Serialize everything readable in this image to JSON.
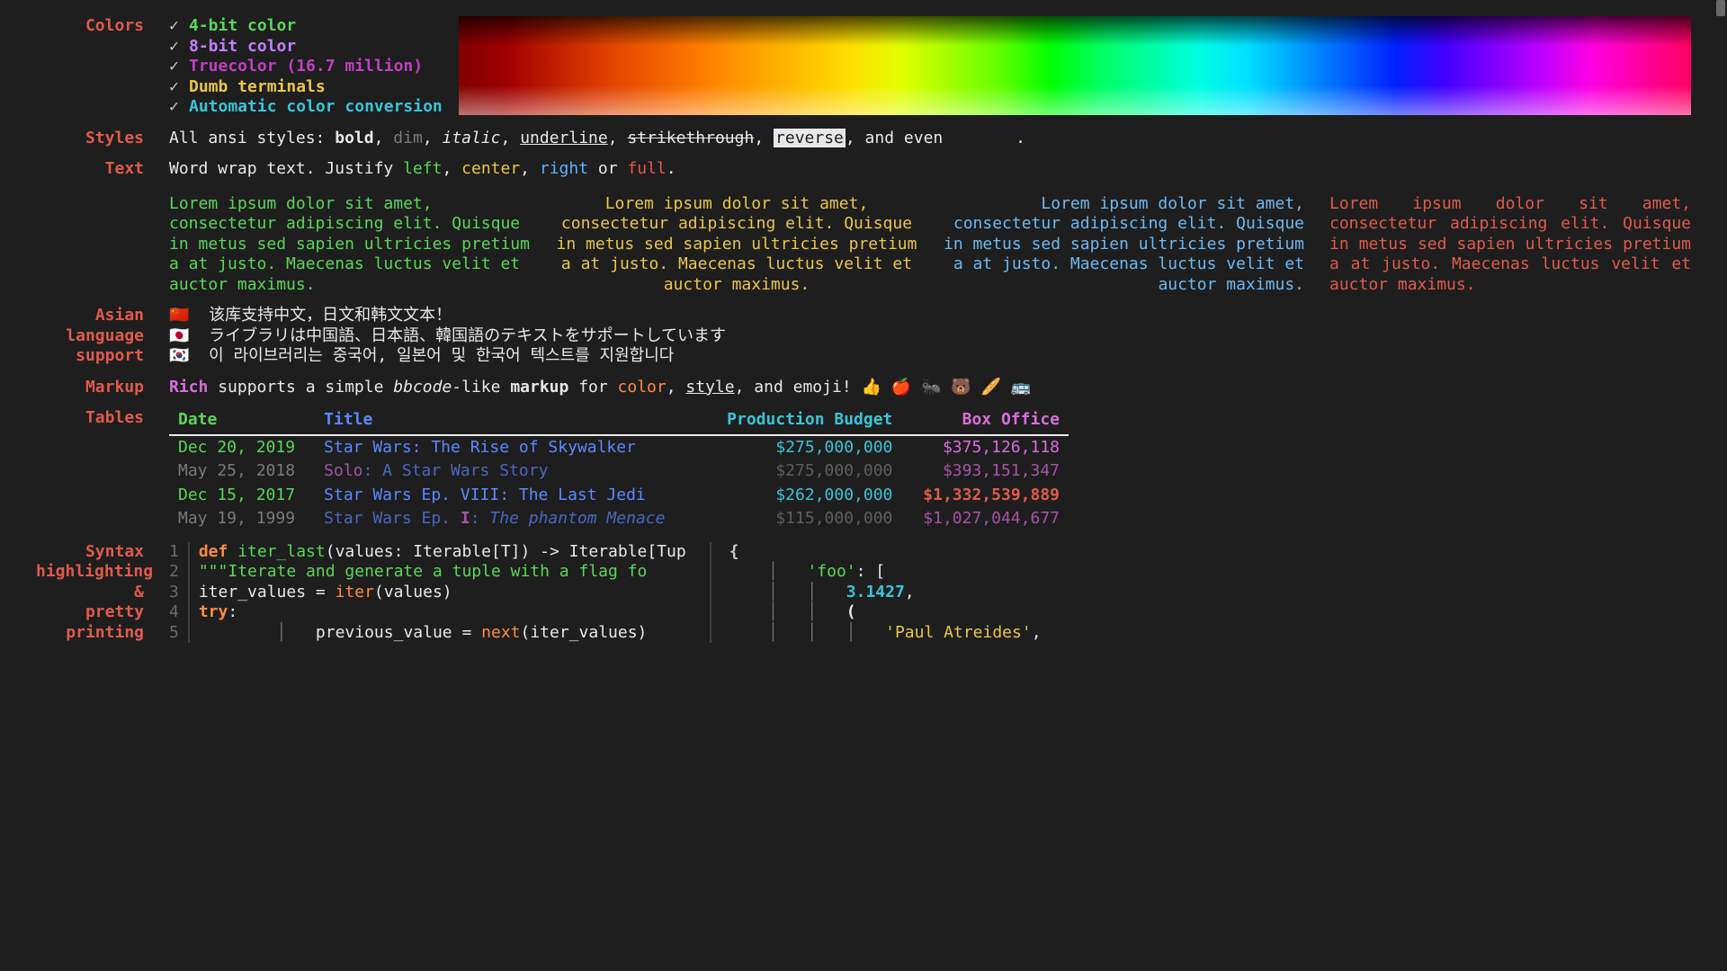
{
  "sections": {
    "colors_label": "Colors",
    "styles_label": "Styles",
    "text_label": "Text",
    "asian_label_l1": "Asian",
    "asian_label_l2": "language",
    "asian_label_l3": "support",
    "markup_label": "Markup",
    "tables_label": "Tables",
    "syntax_label_l1": "Syntax",
    "syntax_label_l2": "highlighting",
    "syntax_label_l3": "&",
    "syntax_label_l4": "pretty",
    "syntax_label_l5": "printing"
  },
  "colors": {
    "items": [
      "4-bit color",
      "8-bit color",
      "Truecolor (16.7 million)",
      "Dumb terminals",
      "Automatic color conversion"
    ]
  },
  "styles": {
    "prefix": "All ansi styles: ",
    "bold": "bold",
    "dim": "dim",
    "italic": "italic",
    "underline": "underline",
    "strike": "strikethrough",
    "reverse": "reverse",
    "and_even": ", and even ",
    "period": ".",
    "sep": ", "
  },
  "text": {
    "line": "Word wrap text. Justify ",
    "left": "left",
    "center": "center",
    "right": "right",
    "or": " or ",
    "full": "full",
    "dot": ".",
    "sep": ", ",
    "lorem": "Lorem ipsum dolor sit amet, consectetur adipiscing elit. Quisque in metus sed sapien ultricies pretium a at justo. Maecenas luctus velit et auctor maximus."
  },
  "asian": {
    "cn_flag": "🇨🇳",
    "jp_flag": "🇯🇵",
    "kr_flag": "🇰🇷",
    "cn": "该库支持中文，日文和韩文文本！",
    "jp": "ライブラリは中国語、日本語、韓国語のテキストをサポートしています",
    "kr": "이 라이브러리는 중국어, 일본어 및 한국어 텍스트를 지원합니다"
  },
  "markup": {
    "rich": "Rich",
    "p1": " supports a simple ",
    "bbcode": "bbcode",
    "p2": "-like ",
    "markup": "markup",
    "p3": " for ",
    "color": "color",
    "sep": ", ",
    "style": "style",
    "p4": ", and emoji! ",
    "emojis": "👍 🍎 🐜 🐻 🥖 🚌"
  },
  "table": {
    "headers": {
      "date": "Date",
      "title": "Title",
      "budget": "Production Budget",
      "box": "Box Office"
    },
    "rows": [
      {
        "date": "Dec 20, 2019",
        "title": "Star Wars: The Rise of Skywalker",
        "budget": "$275,000,000",
        "box": "$375,126,118",
        "dim": false,
        "boxred": false
      },
      {
        "date": "May 25, 2018",
        "title_a": "Solo",
        "title_b": ": A Star Wars Story",
        "budget": "$275,000,000",
        "box": "$393,151,347",
        "dim": true,
        "boxred": false,
        "split": true
      },
      {
        "date": "Dec 15, 2017",
        "title": "Star Wars Ep. VIII: The Last Jedi",
        "budget": "$262,000,000",
        "box": "$1,332,539,889",
        "dim": false,
        "boxred": true
      },
      {
        "date": "May 19, 1999",
        "title_a": "Star Wars Ep. ",
        "title_b": "I",
        "title_c": ": ",
        "title_d": "The phantom Menace",
        "budget": "$115,000,000",
        "box": "$1,027,044,677",
        "dim": true,
        "boxred": false,
        "wiki": true
      }
    ]
  },
  "code": {
    "gutter": [
      "1",
      "2",
      "3",
      "4",
      "5"
    ],
    "l1": {
      "def": "def ",
      "fn": "iter_last",
      "sig1": "(values: Iterable[T]) -> Iterable[Tup"
    },
    "l2": {
      "indent": "    ",
      "doc": "\"\"\"Iterate and generate a tuple with a flag fo"
    },
    "l3": {
      "indent": "    ",
      "a": "iter_values = ",
      "b": "iter",
      "c": "(values)"
    },
    "l4": {
      "indent": "    ",
      "a": "try",
      "b": ":"
    },
    "l5": {
      "indent": "        ",
      "a": "previous_value = ",
      "b": "next",
      "c": "(iter_values)"
    },
    "right": {
      "brace": "{",
      "key": "'foo'",
      "colon": ": [",
      "num": "3.1427",
      "comma": ",",
      "paren": "(",
      "str": "'Paul Atreides'",
      "str_comma": ","
    }
  }
}
